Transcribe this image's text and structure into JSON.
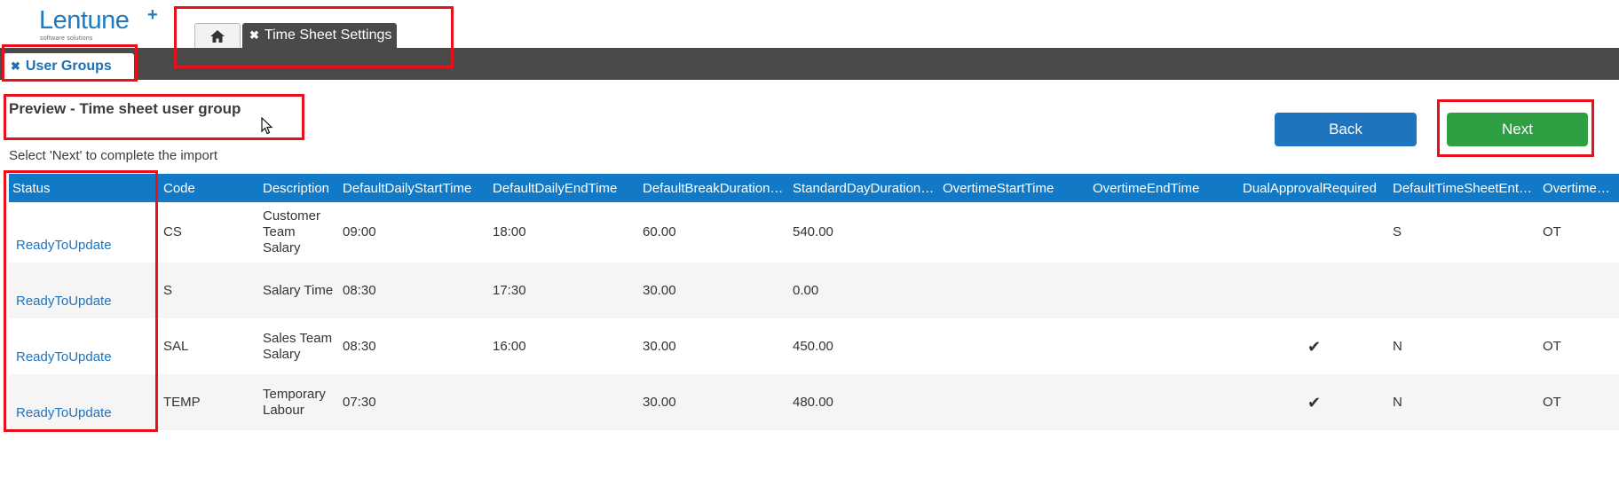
{
  "logo": {
    "brand": "Lentune",
    "plus": "+",
    "tagline": "software solutions"
  },
  "tabs": {
    "home_icon": "home-icon",
    "active_close": "✖",
    "active_label": "Time Sheet Settings"
  },
  "subtab": {
    "close": "✖",
    "label": "User Groups"
  },
  "page": {
    "title": "Preview - Time sheet user group",
    "hint": "Select 'Next' to complete the import"
  },
  "buttons": {
    "back": "Back",
    "next": "Next"
  },
  "colors": {
    "accent": "#1279c6",
    "next_green": "#2ea043",
    "highlight": "#e8101a",
    "band": "#4a4a4a"
  },
  "table": {
    "columns": [
      "Status",
      "Code",
      "Description",
      "DefaultDailyStartTime",
      "DefaultDailyEndTime",
      "DefaultBreakDuration…",
      "StandardDayDuration…",
      "OvertimeStartTime",
      "OvertimeEndTime",
      "DualApprovalRequired",
      "DefaultTimeSheetEntr…",
      "OvertimeTime"
    ],
    "rows": [
      [
        "ReadyToUpdate",
        "CS",
        "Customer Team Salary",
        "09:00",
        "18:00",
        "60.00",
        "540.00",
        "",
        "",
        "",
        "S",
        "OT"
      ],
      [
        "ReadyToUpdate",
        "S",
        "Salary Time",
        "08:30",
        "17:30",
        "30.00",
        "0.00",
        "",
        "",
        "",
        "",
        ""
      ],
      [
        "ReadyToUpdate",
        "SAL",
        "Sales Team Salary",
        "08:30",
        "16:00",
        "30.00",
        "450.00",
        "",
        "",
        "✔",
        "N",
        "OT"
      ],
      [
        "ReadyToUpdate",
        "TEMP",
        "Temporary Labour",
        "07:30",
        "",
        "30.00",
        "480.00",
        "",
        "",
        "✔",
        "N",
        "OT"
      ]
    ]
  }
}
